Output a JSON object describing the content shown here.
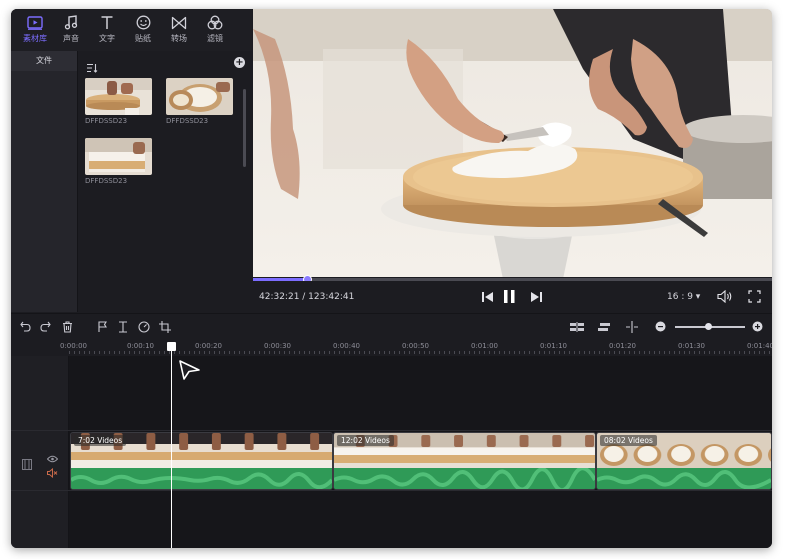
{
  "categories": [
    {
      "label": "素材库",
      "icon": "media-library-icon",
      "active": true
    },
    {
      "label": "声音",
      "icon": "music-note-icon",
      "active": false
    },
    {
      "label": "文字",
      "icon": "text-icon",
      "active": false
    },
    {
      "label": "贴纸",
      "icon": "sticker-icon",
      "active": false
    },
    {
      "label": "转场",
      "icon": "transition-icon",
      "active": false
    },
    {
      "label": "滤镜",
      "icon": "filter-icon",
      "active": false
    }
  ],
  "sidebar": {
    "file_label": "文件"
  },
  "media": [
    {
      "label": "DFFDSSD23"
    },
    {
      "label": "DFFDSSD23"
    },
    {
      "label": "DFFDSSD23"
    }
  ],
  "player": {
    "timecode": "42:32:21 / 123:42:41",
    "aspect_ratio": "16 : 9 ▾",
    "progress_fraction": 0.104
  },
  "ruler": {
    "ticks": [
      "0:00:00",
      "0:00:10",
      "0:00:20",
      "0:00:30",
      "0:00:40",
      "0:00:50",
      "0:01:00",
      "0:01:10",
      "0:01:20",
      "0:01:30",
      "0:01:40"
    ]
  },
  "clips": [
    {
      "tag": "7:02  Videos"
    },
    {
      "tag": "12:02  Videos"
    },
    {
      "tag": "08:02  Videos"
    }
  ],
  "colors": {
    "accent": "#7c6dff",
    "waveform": "#2f9a57",
    "panel": "#1c1c21"
  }
}
